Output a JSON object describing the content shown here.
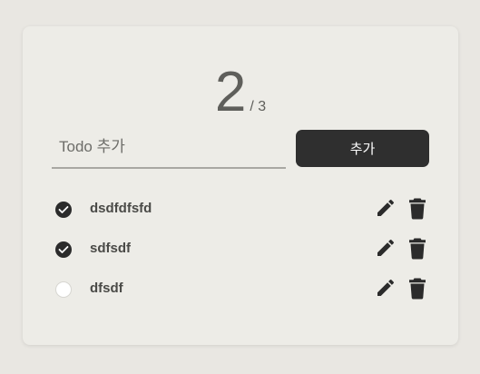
{
  "counter": {
    "done": "2",
    "total": "/ 3"
  },
  "input": {
    "placeholder": "Todo 추가",
    "value": ""
  },
  "add_button": {
    "label": "추가"
  },
  "todos": [
    {
      "text": "dsdfdfsfd",
      "done": true
    },
    {
      "text": "sdfsdf",
      "done": true
    },
    {
      "text": "dfsdf",
      "done": false
    }
  ],
  "colors": {
    "background": "#e9e7e2",
    "card": "#edece7",
    "button": "#2f2f2f",
    "icon": "#2b2b2b"
  },
  "icons": {
    "check": "check-icon",
    "edit": "pencil-icon",
    "delete": "trash-icon"
  }
}
